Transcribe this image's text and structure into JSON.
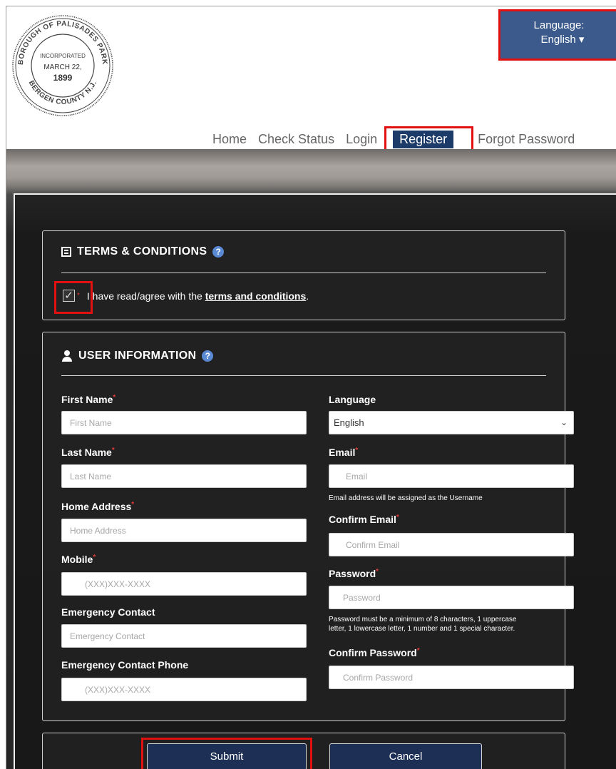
{
  "header": {
    "seal": {
      "ring_top": "BOROUGH OF PALISADES PARK",
      "ring_bottom": "BERGEN COUNTY N.J.",
      "inner_1": "INCORPORATED",
      "inner_2": "MARCH 22,",
      "inner_3": "1899"
    },
    "language_label": "Language:",
    "language_value": "English",
    "language_caret": "▾"
  },
  "nav": {
    "home": "Home",
    "check_status": "Check Status",
    "login": "Login",
    "register": "Register",
    "forgot_password": "Forgot Password"
  },
  "terms": {
    "title": "TERMS & CONDITIONS",
    "help": "?",
    "checked_mark": "✓",
    "required_mark": "*",
    "text_before": "I have read/agree with the ",
    "link": "terms and conditions",
    "text_after": "."
  },
  "user_info": {
    "title": "USER INFORMATION",
    "help": "?",
    "first_name": {
      "label": "First Name",
      "placeholder": "First Name"
    },
    "last_name": {
      "label": "Last Name",
      "placeholder": "Last Name"
    },
    "home_address": {
      "label": "Home Address",
      "placeholder": "Home Address"
    },
    "mobile": {
      "label": "Mobile",
      "placeholder": "(XXX)XXX-XXXX"
    },
    "emergency_contact": {
      "label": "Emergency Contact",
      "placeholder": "Emergency Contact"
    },
    "emergency_phone": {
      "label": "Emergency Contact Phone",
      "placeholder": "(XXX)XXX-XXXX"
    },
    "language": {
      "label": "Language",
      "value": "English"
    },
    "email": {
      "label": "Email",
      "placeholder": "Email",
      "hint": "Email address will be assigned as the Username"
    },
    "confirm_email": {
      "label": "Confirm Email",
      "placeholder": "Confirm Email"
    },
    "password": {
      "label": "Password",
      "placeholder": "Password",
      "hint_1": "Password must be a minimum of 8 characters, 1 uppercase",
      "hint_2": "letter, 1 lowercase letter, 1 number and 1 special character."
    },
    "confirm_password": {
      "label": "Confirm Password",
      "placeholder": "Confirm Password"
    },
    "required_mark": "*"
  },
  "actions": {
    "submit": "Submit",
    "cancel": "Cancel"
  },
  "colors": {
    "nav_active_bg": "#1d3b68",
    "language_bg": "#3c5a8c",
    "button_bg": "#1d2f55",
    "highlight": "#e21111"
  }
}
